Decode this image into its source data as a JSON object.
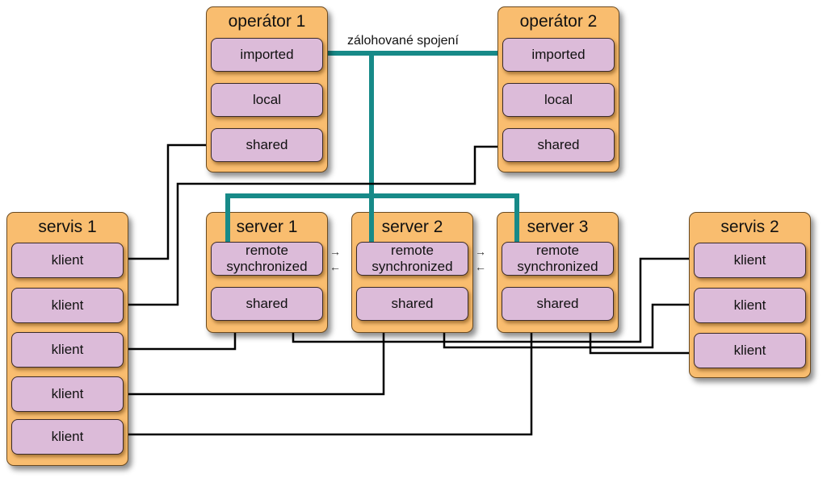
{
  "diagram": {
    "backup_label": "zálohované spojení",
    "colors": {
      "group_fill": "#f9bd6f",
      "item_fill": "#dcbbd9",
      "backup_line": "#178a88",
      "wire": "#000000"
    },
    "operators": [
      {
        "title": "operátor 1",
        "items": [
          "imported",
          "local",
          "shared"
        ]
      },
      {
        "title": "operátor 2",
        "items": [
          "imported",
          "local",
          "shared"
        ]
      }
    ],
    "servers": [
      {
        "title": "server 1",
        "items": [
          [
            "remote",
            "synchronized"
          ],
          "shared"
        ]
      },
      {
        "title": "server 2",
        "items": [
          [
            "remote",
            "synchronized"
          ],
          "shared"
        ]
      },
      {
        "title": "server 3",
        "items": [
          [
            "remote",
            "synchronized"
          ],
          "shared"
        ]
      }
    ],
    "services": [
      {
        "title": "servis 1",
        "items": [
          "klient",
          "klient",
          "klient",
          "klient",
          "klient"
        ]
      },
      {
        "title": "servis 2",
        "items": [
          "klient",
          "klient",
          "klient"
        ]
      }
    ],
    "sync_arrows": [
      "→",
      "←",
      "→",
      "←"
    ]
  }
}
